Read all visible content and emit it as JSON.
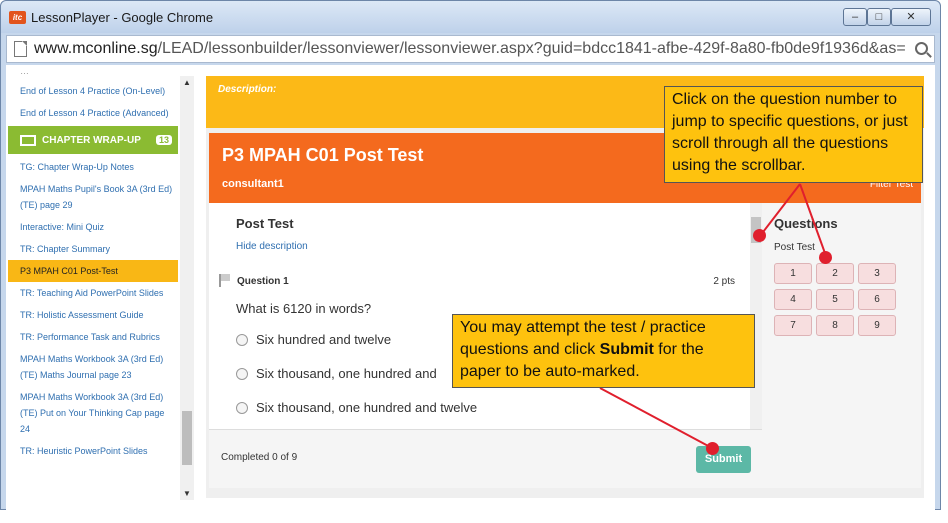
{
  "window": {
    "title": "LessonPlayer - Google Chrome",
    "app_icon_text": "itc"
  },
  "address": {
    "url_host": "www.mconline.sg",
    "url_path": "/LEAD/lessonbuilder/lessonviewer/lessonviewer.aspx?guid=bdcc1841-afbe-429f-8a80-fb0de9f1936d&as="
  },
  "sidebar": {
    "top_partial": "…",
    "items": [
      "End of Lesson 4 Practice (On-Level)",
      "End of Lesson 4 Practice (Advanced)",
      "CHAPTER WRAP-UP",
      "TG: Chapter Wrap-Up Notes",
      "MPAH Maths Pupil's Book 3A (3rd Ed)(TE) page 29",
      "Interactive: Mini Quiz",
      "TR: Chapter Summary",
      "P3 MPAH C01 Post-Test",
      "TR: Teaching Aid PowerPoint Slides",
      "TR: Holistic Assessment Guide",
      "TR: Performance Task and Rubrics",
      "MPAH Maths Workbook 3A (3rd Ed)(TE) Maths Journal page 23",
      "MPAH Maths Workbook 3A (3rd Ed)(TE) Put on Your Thinking Cap page 24",
      "TR: Heuristic PowerPoint Slides"
    ],
    "chapter_badge": "13"
  },
  "main": {
    "description_label": "Description:",
    "test_title": "P3 MPAH C01 Post Test",
    "user": "consultant1",
    "filter_label": "Filter Test",
    "section_title": "Post Test",
    "hide_description": "Hide description",
    "question_label": "Question 1",
    "points": "2 pts",
    "question_text": "What is 6120 in words?",
    "options": [
      "Six hundred and twelve",
      "Six thousand, one hundred and",
      "Six thousand, one hundred and twelve"
    ],
    "completed": "Completed 0 of 9",
    "submit": "Submit"
  },
  "questions_panel": {
    "title": "Questions",
    "subtitle": "Post Test",
    "numbers": [
      "1",
      "2",
      "3",
      "4",
      "5",
      "6",
      "7",
      "8",
      "9"
    ]
  },
  "callouts": {
    "top": "Click on the question number to jump to specific questions, or just scroll through all the questions using the scrollbar.",
    "bottom_pre": "You may attempt the test / practice questions and click ",
    "bottom_bold": "Submit",
    "bottom_post": " for the paper to be auto-marked."
  },
  "colors": {
    "accent_orange": "#f46a1e",
    "accent_yellow": "#fcb917",
    "chapter_green": "#8bbb32",
    "submit_teal": "#5cb8a6",
    "annotation_red": "#e01f2d"
  }
}
